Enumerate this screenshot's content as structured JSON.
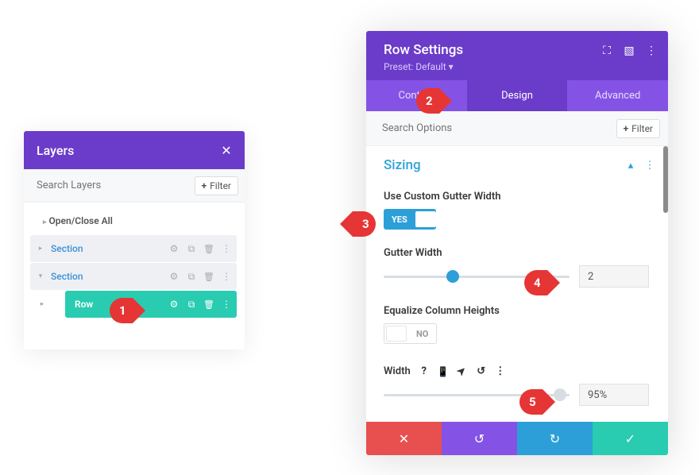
{
  "layers": {
    "title": "Layers",
    "search_placeholder": "Search Layers",
    "filter_label": "Filter",
    "open_close_all": "Open/Close All",
    "section_label_1": "Section",
    "section_label_2": "Section",
    "row_label": "Row"
  },
  "settings": {
    "title": "Row Settings",
    "preset": "Preset: Default",
    "tabs": {
      "content": "Content",
      "design": "Design",
      "advanced": "Advanced"
    },
    "search_placeholder": "Search Options",
    "filter_label": "Filter",
    "section_sizing": "Sizing",
    "use_custom_gutter": "Use Custom Gutter Width",
    "custom_gutter_toggle": "YES",
    "gutter_width_label": "Gutter Width",
    "gutter_width_value": "2",
    "gutter_slider_percent": 37,
    "equalize_label": "Equalize Column Heights",
    "equalize_toggle": "NO",
    "width_label": "Width",
    "width_value": "95%",
    "width_slider_percent": 95
  },
  "annotations": {
    "a1": "1",
    "a2": "2",
    "a3": "3",
    "a4": "4",
    "a5": "5"
  }
}
